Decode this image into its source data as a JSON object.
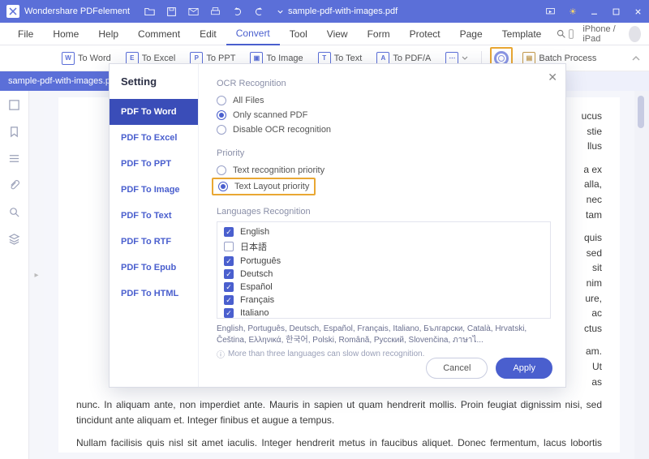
{
  "app": {
    "name": "Wondershare PDFelement",
    "docname": "sample-pdf-with-images.pdf"
  },
  "menubar": {
    "items": [
      "File",
      "Home",
      "Help",
      "Comment",
      "Edit",
      "Convert",
      "Tool",
      "View",
      "Form",
      "Protect",
      "Page",
      "Template"
    ],
    "active": "Convert",
    "device": "iPhone / iPad"
  },
  "toolbar": {
    "to_word": "To Word",
    "to_excel": "To Excel",
    "to_ppt": "To PPT",
    "to_image": "To Image",
    "to_text": "To Text",
    "to_pdfa": "To PDF/A",
    "batch": "Batch Process"
  },
  "tab": {
    "name": "sample-pdf-with-images.pdf"
  },
  "dialog": {
    "title": "Setting",
    "side_items": [
      "PDF To Word",
      "PDF To Excel",
      "PDF To PPT",
      "PDF To Image",
      "PDF To Text",
      "PDF To RTF",
      "PDF To Epub",
      "PDF To HTML"
    ],
    "ocr_label": "OCR Recognition",
    "ocr_opts": {
      "all": "All Files",
      "scanned": "Only scanned PDF",
      "disable": "Disable OCR recognition"
    },
    "priority_label": "Priority",
    "priority_opts": {
      "text": "Text recognition priority",
      "layout": "Text Layout priority"
    },
    "lang_label": "Languages Recognition",
    "langs": [
      {
        "label": "English",
        "checked": true
      },
      {
        "label": "日本語",
        "checked": false
      },
      {
        "label": "Português",
        "checked": true
      },
      {
        "label": "Deutsch",
        "checked": true
      },
      {
        "label": "Español",
        "checked": true
      },
      {
        "label": "Français",
        "checked": true
      },
      {
        "label": "Italiano",
        "checked": true
      }
    ],
    "langs_summary": "English, Português, Deutsch, Español, Français, Italiano, Български, Català, Hrvatski, Čeština, Ελληνικά, 한국어, Polski, Română, Русский, Slovenčina, ภาษาไ...",
    "langs_note": "More than three languages can slow down recognition.",
    "cancel": "Cancel",
    "apply": "Apply"
  },
  "bodytext": {
    "p1a": "ucus",
    "p1b": "stie",
    "p1c": "llus",
    "p2a": "a ex",
    "p2b": "alla,",
    "p2c": "nec",
    "p2d": "tam",
    "p3a": "quis",
    "p3b": "sed",
    "p3c": "sit",
    "p3d": "nim",
    "p3e": "ure,",
    "p3f": "ac",
    "p3g": "ctus",
    "p4a": "am.",
    "p4b": "Ut",
    "p4c": "as",
    "full1": "nunc. In aliquam ante, non imperdiet ante. Mauris in sapien ut quam hendrerit mollis. Proin feugiat dignissim nisi, sed tincidunt ante aliquam et. Integer finibus et augue a tempus.",
    "full2": "Nullam facilisis quis nisl sit amet iaculis. Integer hendrerit metus in faucibus aliquet. Donec fermentum, lacus lobortis pulvinar vestibulum, dolor ante congue mi, ac pulvinar lacus magna"
  }
}
